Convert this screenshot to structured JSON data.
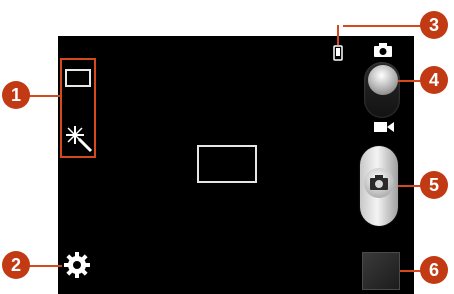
{
  "callouts": {
    "c1": "1",
    "c2": "2",
    "c3": "3",
    "c4": "4",
    "c5": "5",
    "c6": "6"
  },
  "icons": {
    "shooting_mode": "rectangle-icon",
    "effect": "magic-wand-icon",
    "settings": "gear-icon",
    "storage": "phone-storage-icon",
    "camera_mode": "camera-icon",
    "video_mode": "video-camera-icon",
    "shutter": "camera-icon"
  },
  "colors": {
    "viewfinder_bg": "#000000",
    "callout": "#c23a14",
    "highlight_border": "#d44a1c",
    "focus_frame": "#e6e6e6"
  },
  "camera_mode_switch": {
    "selected": "camera"
  }
}
